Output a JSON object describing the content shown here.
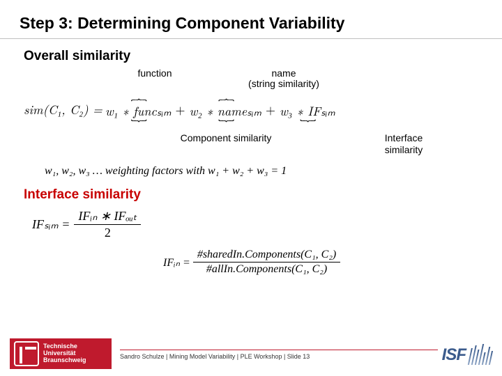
{
  "title": "Step 3: Determining Component Variability",
  "section_overall": "Overall similarity",
  "annot": {
    "function": "function",
    "name_line1": "name",
    "name_line2": "(string similarity)",
    "component_similarity": "Component similarity",
    "interface_similarity_line1": "Interface",
    "interface_similarity_line2": "similarity"
  },
  "formula": {
    "sim_lhs": "sim(C₁, C₂) =",
    "term1": "w₁ ∗ funcₛᵢₘ",
    "term2": "w₂ ∗ nameₛᵢₘ",
    "term3": "w₃ ∗ IFₛᵢₘ",
    "plus": "+",
    "weights": "w₁, w₂, w₃ … weighting factors with w₁ + w₂ + w₃ = 1"
  },
  "section_interface": "Interface similarity",
  "if_formula": {
    "lhs": "IFₛᵢₘ =",
    "num": "IFᵢₙ ∗ IFₒᵤₜ",
    "den": "2"
  },
  "ifin_formula": {
    "lhs": "IFᵢₙ =",
    "num": "#sharedIn.Components(C₁, C₂)",
    "den": "#allIn.Components(C₁, C₂)"
  },
  "footer": {
    "tu_line1": "Technische",
    "tu_line2": "Universität",
    "tu_line3": "Braunschweig",
    "text": "Sandro Schulze | Mining Model Variability | PLE Workshop | Slide 13",
    "isf": "ISF"
  }
}
